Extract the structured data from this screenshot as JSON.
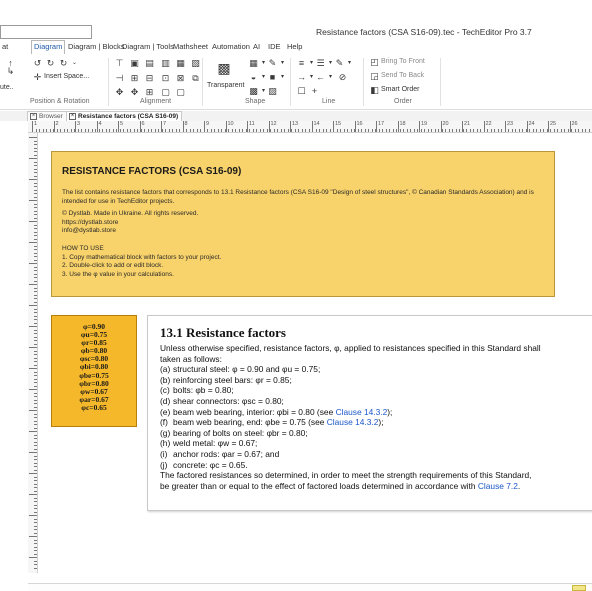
{
  "window": {
    "title": "Resistance factors (CSA S16-09).tec - TechEditor Pro 3.7"
  },
  "menu": {
    "items": [
      "at",
      "Diagram",
      "Diagram | Blocks",
      "Diagram | Tools",
      "Mathsheet",
      "Automation",
      "AI",
      "IDE",
      "Help"
    ],
    "active_index": 1
  },
  "ribbon": {
    "insert_space_label": "Insert Space...",
    "truncated_label": "ute..",
    "transparent_label": "Transparent",
    "bring_to_front_label": "Bring To Front",
    "send_to_back_label": "Send To Back",
    "smart_order_label": "Smart Order",
    "groups": {
      "position": "Position & Rotation",
      "alignment": "Alignment",
      "shape": "Shape",
      "line": "Line",
      "order": "Order"
    }
  },
  "tabs": {
    "browser": "Browser",
    "document": "Resistance factors (CSA S16-09)"
  },
  "ruler": {
    "numbers": [
      "1",
      "2",
      "3",
      "4",
      "5",
      "6",
      "7",
      "8",
      "9",
      "10",
      "11",
      "12",
      "13",
      "14",
      "15",
      "16",
      "17",
      "18",
      "19",
      "20",
      "21",
      "22",
      "23",
      "24",
      "25",
      "26"
    ]
  },
  "info_block": {
    "title": "RESISTANCE FACTORS (CSA S16-09)",
    "description": "The list contains resistance factors that corresponds to 13.1 Resistance factors (CSA S16-09 \"Design of steel structures\", © Canadian Standards Association) and is intended for use in TechEditor projects.",
    "copyright": "© Dystlab. Made in Ukraine. All rights reserved.",
    "website": "https://dystlab.store",
    "email": "info@dystlab.store",
    "howto_title": "HOW TO USE",
    "howto_steps": [
      "1. Copy mathematical block with factors to your project.",
      "2. Double-click to add or edit block.",
      "3. Use the φ value in your calculations."
    ]
  },
  "factors": [
    "φ=0.90",
    "φu=0.75",
    "φr=0.85",
    "φb=0.80",
    "φsc=0.80",
    "φbi=0.80",
    "φbe=0.75",
    "φbr=0.80",
    "φw=0.67",
    "φar=0.67",
    "φc=0.65"
  ],
  "standard": {
    "heading": "13.1 Resistance factors",
    "intro_1": "Unless otherwise specified, resistance factors, φ, applied to resistances specified in this Standard shall",
    "intro_2": "taken as follows:",
    "items": [
      {
        "label": "(a)",
        "text": "structural steel: φ = 0.90 and φu = 0.75;",
        "link": ""
      },
      {
        "label": "(b)",
        "text": "reinforcing steel bars: φr = 0.85;",
        "link": ""
      },
      {
        "label": "(c)",
        "text": "bolts: φb = 0.80;",
        "link": ""
      },
      {
        "label": "(d)",
        "text": "shear connectors: φsc = 0.80;",
        "link": ""
      },
      {
        "label": "(e)",
        "text": "beam web bearing, interior: φbi = 0.80 (see ",
        "link": "Clause 14.3.2",
        "after": ");"
      },
      {
        "label": "(f)",
        "text": "beam web bearing, end: φbe = 0.75 (see ",
        "link": "Clause 14.3.2",
        "after": ");"
      },
      {
        "label": "(g)",
        "text": "bearing of bolts on steel: φbr = 0.80;",
        "link": ""
      },
      {
        "label": "(h)",
        "text": "weld metal: φw = 0.67;",
        "link": ""
      },
      {
        "label": "(i)",
        "text": "anchor rods: φar = 0.67; and",
        "link": ""
      },
      {
        "label": "(j)",
        "text": "concrete: φc = 0.65.",
        "link": ""
      }
    ],
    "closing_1": "The factored resistances so determined, in order to meet the strength requirements of this Standard,",
    "closing_2_text": "be greater than or equal to the effect of factored loads determined in accordance with ",
    "closing_2_link": "Clause 7.2",
    "closing_2_after": "."
  },
  "colors": {
    "info_bg": "#f8d26a",
    "factors_bg": "#f5b82a",
    "link": "#1b57c9",
    "active_menu": "#1d5aa8"
  }
}
